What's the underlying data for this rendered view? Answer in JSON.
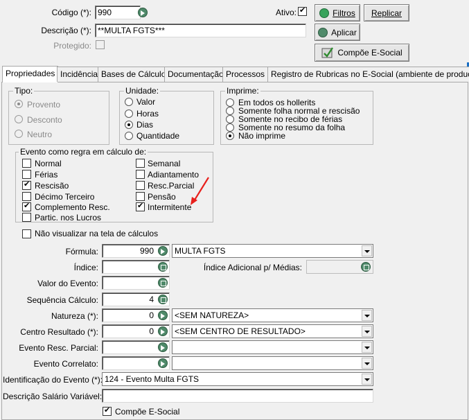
{
  "header": {
    "codigo_label": "Código (*):",
    "codigo_value": "990",
    "descricao_label": "Descrição (*):",
    "descricao_value": "**MULTA FGTS***",
    "protegido_label": "Protegido:",
    "ativo_label": "Ativo:",
    "ativo_checked": true,
    "filtros_label": "Filtros",
    "replicar_label": "Replicar",
    "aplicar_label": "Aplicar",
    "compoe_esocial_button_label": "Compõe E-Social"
  },
  "tabs": [
    {
      "label": "Propriedades",
      "active": true
    },
    {
      "label": "Incidência"
    },
    {
      "label": "Bases de Cálculo"
    },
    {
      "label": "Documentação"
    },
    {
      "label": "Processos"
    },
    {
      "label": "Registro de Rubricas no E-Social (ambiente de produção)"
    }
  ],
  "tipo": {
    "title": "Tipo:",
    "options": [
      "Provento",
      "Desconto",
      "Neutro"
    ],
    "selected": "Provento"
  },
  "unidade": {
    "title": "Unidade:",
    "options": [
      "Valor",
      "Horas",
      "Dias",
      "Quantidade"
    ],
    "selected": "Dias"
  },
  "imprime": {
    "title": "Imprime:",
    "options": [
      "Em todos os hollerits",
      "Somente folha normal e rescisão",
      "Somente no recibo de férias",
      "Somente no resumo da folha",
      "Não imprime"
    ],
    "selected": "Não imprime"
  },
  "evento": {
    "title": "Evento como regra em cálculo de:",
    "left": [
      {
        "label": "Normal",
        "checked": false
      },
      {
        "label": "Férias",
        "checked": false
      },
      {
        "label": "Rescisão",
        "checked": true
      },
      {
        "label": "Décimo Terceiro",
        "checked": false
      },
      {
        "label": "Complemento Resc.",
        "checked": true
      },
      {
        "label": "Partic. nos Lucros",
        "checked": false
      }
    ],
    "right": [
      {
        "label": "Semanal",
        "checked": false
      },
      {
        "label": "Adiantamento",
        "checked": false
      },
      {
        "label": "Resc.Parcial",
        "checked": false
      },
      {
        "label": "Pensão",
        "checked": false
      },
      {
        "label": "Intermitente",
        "checked": true
      }
    ]
  },
  "nao_visualizar_label": "Não visualizar na tela de cálculos",
  "fields": {
    "formula_label": "Fórmula:",
    "formula_value": "990",
    "formula_desc": "MULTA FGTS",
    "indice_label": "Índice:",
    "indice_adicional_label": "Índice Adicional p/ Médias:",
    "valor_evento_label": "Valor do Evento:",
    "sequencia_label": "Sequência Cálculo:",
    "sequencia_value": "4",
    "natureza_label": "Natureza (*):",
    "natureza_value": "0",
    "natureza_desc": "<SEM NATUREZA>",
    "centro_label": "Centro Resultado (*):",
    "centro_value": "0",
    "centro_desc": "<SEM CENTRO DE RESULTADO>",
    "resc_parcial_label": "Evento Resc. Parcial:",
    "correlato_label": "Evento Correlato:",
    "identificacao_label": "Identificação do Evento (*):",
    "identificacao_value": "124 - Evento Multa FGTS",
    "desc_salario_label": "Descrição Salário Variável:",
    "compoe_esocial_label": "Compõe E-Social",
    "compoe_esocial_checked": true
  },
  "colors": {
    "annotation_arrow": "#e8201c",
    "icon_green": "#4f8a6a"
  }
}
